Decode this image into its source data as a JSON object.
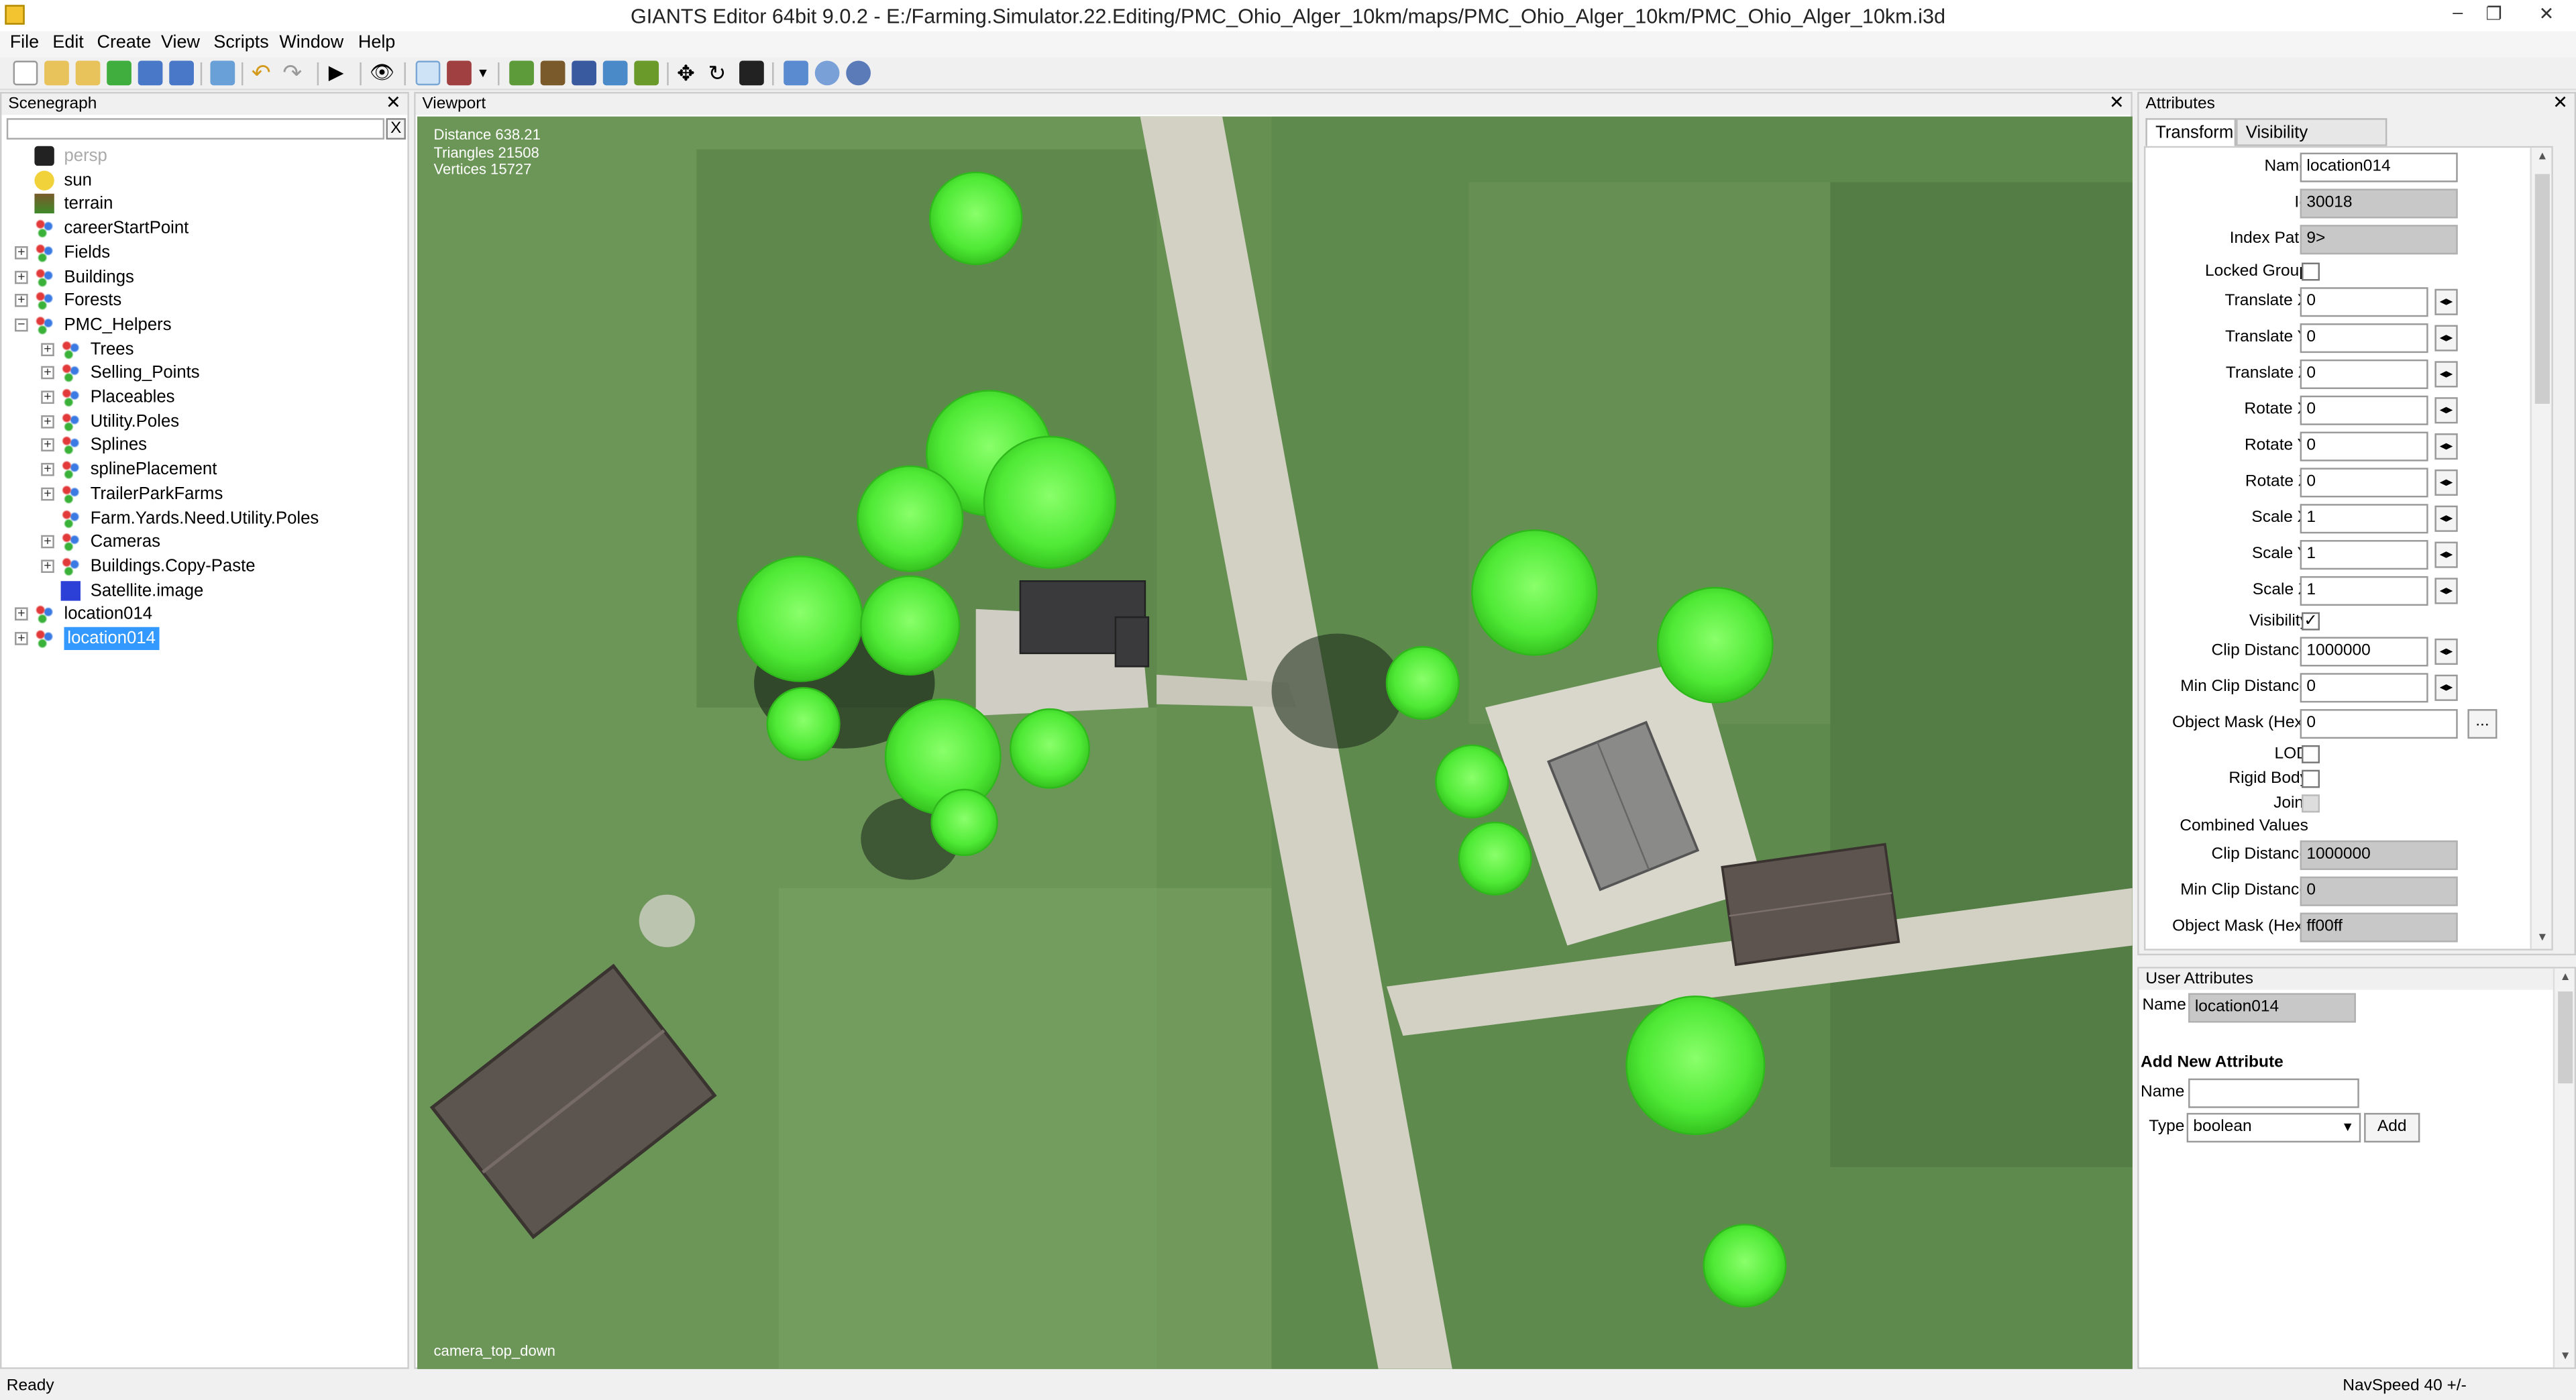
{
  "window": {
    "title": "GIANTS Editor 64bit 9.0.2 - E:/Farming.Simulator.22.Editing/PMC_Ohio_Alger_10km/maps/PMC_Ohio_Alger_10km/PMC_Ohio_Alger_10km.i3d",
    "minimize": "–",
    "restore": "❐",
    "close": "✕"
  },
  "menu": [
    "File",
    "Edit",
    "Create",
    "View",
    "Scripts",
    "Window",
    "Help"
  ],
  "scenegraph": {
    "title": "Scenegraph",
    "close": "✕",
    "search_clear": "X",
    "items": [
      {
        "label": "persp",
        "icon": "camera-icon"
      },
      {
        "label": "sun",
        "icon": "lightbulb-icon"
      },
      {
        "label": "terrain",
        "icon": "terrain-icon"
      },
      {
        "label": "careerStartPoint",
        "icon": "transform-group-icon"
      },
      {
        "label": "Fields",
        "icon": "transform-group-icon"
      },
      {
        "label": "Buildings",
        "icon": "transform-group-icon"
      },
      {
        "label": "Forests",
        "icon": "transform-group-icon"
      },
      {
        "label": "PMC_Helpers",
        "icon": "transform-group-icon"
      },
      {
        "label": "Trees",
        "icon": "transform-group-icon"
      },
      {
        "label": "Selling_Points",
        "icon": "transform-group-icon"
      },
      {
        "label": "Placeables",
        "icon": "transform-group-icon"
      },
      {
        "label": "Utility.Poles",
        "icon": "transform-group-icon"
      },
      {
        "label": "Splines",
        "icon": "transform-group-icon"
      },
      {
        "label": "splinePlacement",
        "icon": "transform-group-icon"
      },
      {
        "label": "TrailerParkFarms",
        "icon": "transform-group-icon"
      },
      {
        "label": "Farm.Yards.Need.Utility.Poles",
        "icon": "transform-group-icon"
      },
      {
        "label": "Cameras",
        "icon": "transform-group-icon"
      },
      {
        "label": "Buildings.Copy-Paste",
        "icon": "transform-group-icon"
      },
      {
        "label": "Satellite.image",
        "icon": "shape-cube-icon"
      },
      {
        "label": "location014",
        "icon": "transform-group-icon"
      },
      {
        "label": "location014",
        "icon": "transform-group-icon"
      }
    ]
  },
  "viewport": {
    "title": "Viewport",
    "close": "✕",
    "stats": {
      "distance": "Distance 638.21",
      "triangles": "Triangles 21508",
      "vertices": "Vertices 15727"
    },
    "camera": "camera_top_down"
  },
  "attributes": {
    "title": "Attributes",
    "close": "✕",
    "tabs": [
      "Transform",
      "Visibility Condition"
    ],
    "fields": {
      "name_label": "Name",
      "name": "location014",
      "id_label": "Id",
      "id": "30018",
      "index_label": "Index Path",
      "index": "9>",
      "locked_label": "Locked Group",
      "tx_label": "Translate X",
      "tx": "0",
      "ty_label": "Translate Y",
      "ty": "0",
      "tz_label": "Translate Z",
      "tz": "0",
      "rx_label": "Rotate X",
      "rx": "0",
      "ry_label": "Rotate Y",
      "ry": "0",
      "rz_label": "Rotate Z",
      "rz": "0",
      "sx_label": "Scale X",
      "sx": "1",
      "sy_label": "Scale Y",
      "sy": "1",
      "sz_label": "Scale Z",
      "sz": "1",
      "vis_label": "Visibility",
      "clip_label": "Clip Distance",
      "clip": "1000000",
      "minclip_label": "Min Clip Distance",
      "minclip": "0",
      "mask_label": "Object Mask (Hex)",
      "mask": "0",
      "lod_label": "LOD",
      "rigid_label": "Rigid Body",
      "joint_label": "Joint",
      "combined_label": "Combined Values",
      "c_clip_label": "Clip Distance",
      "c_clip": "1000000",
      "c_minclip_label": "Min Clip Distance",
      "c_minclip": "0",
      "c_mask_label": "Object Mask (Hex)",
      "c_mask": "ff00ff",
      "dots": "..."
    }
  },
  "user_attributes": {
    "title": "User Attributes",
    "close": "✕",
    "name_label": "Name",
    "name": "location014",
    "add_heading": "Add New Attribute",
    "new_name_label": "Name",
    "new_name": "",
    "type_label": "Type",
    "type_value": "boolean",
    "add_button": "Add"
  },
  "status": {
    "left": "Ready",
    "right": "NavSpeed 40 +/-"
  },
  "colors": {
    "selection": "#3399ff",
    "tree_green": "#5cf04a",
    "grass": "#5f8a4d",
    "road": "#d6d3c6"
  }
}
